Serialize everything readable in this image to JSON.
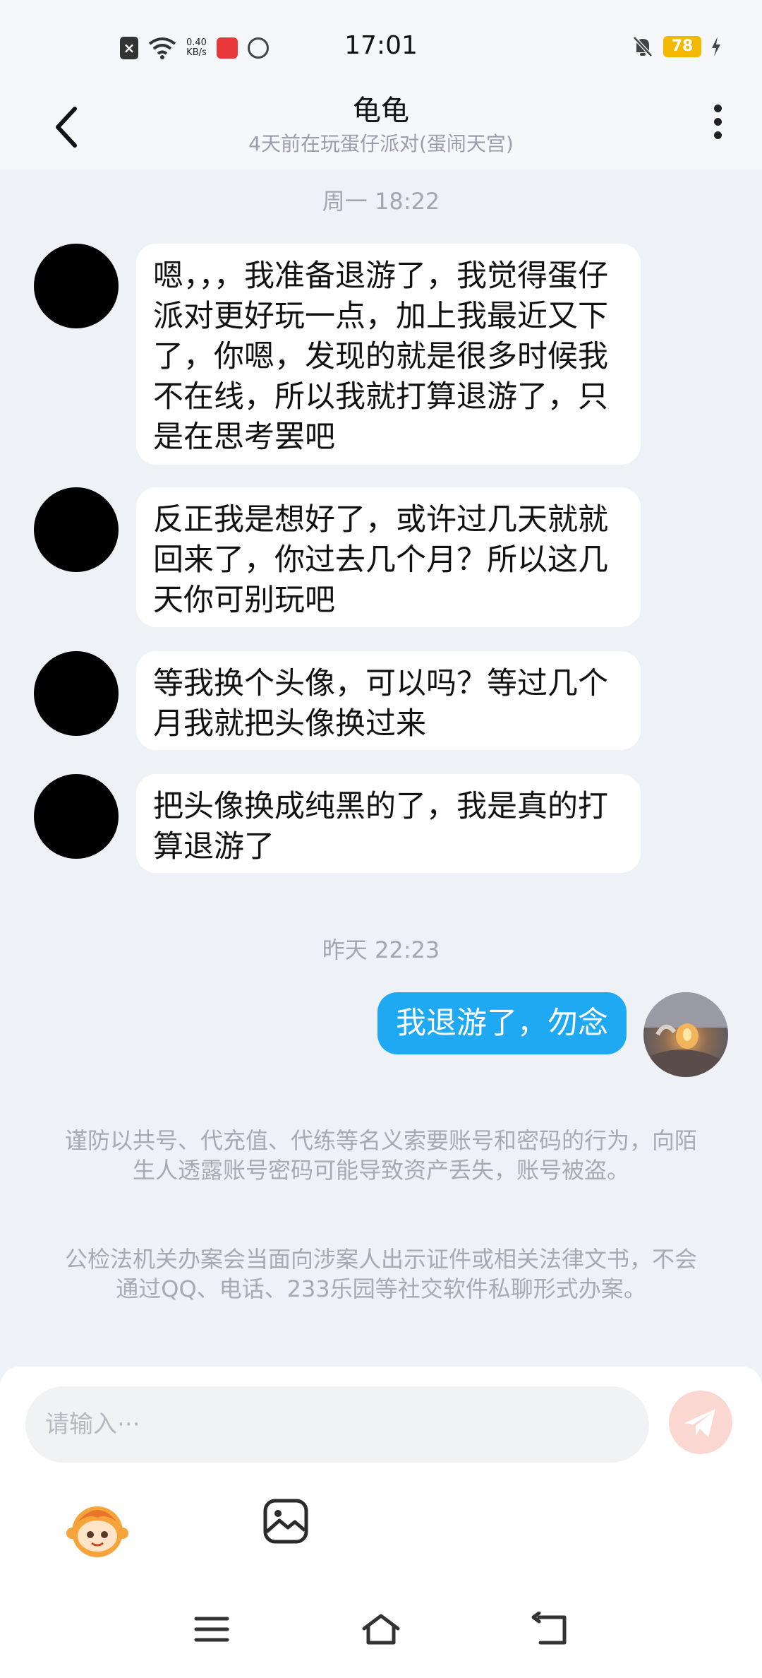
{
  "status_bar": {
    "time": "17:01",
    "net_speed_value": "0.40",
    "net_speed_unit": "KB/s",
    "battery": "78"
  },
  "header": {
    "title": "龟龟",
    "subtitle": "4天前在玩蛋仔派对(蛋闹天宫)"
  },
  "chat": {
    "timestamp1": "周一 18:22",
    "incoming": [
      "嗯，，，我准备退游了，我觉得蛋仔派对更好玩一点，加上我最近又下了，你嗯，发现的就是很多时候我不在线，所以我就打算退游了，只是在思考罢吧",
      "反正我是想好了，或许过几天就就回来了，你过去几个月？所以这几天你可别玩吧",
      "等我换个头像，可以吗？等过几个月我就把头像换过来",
      "把头像换成纯黑的了，我是真的打算退游了"
    ],
    "timestamp2": "昨天 22:23",
    "outgoing": "我退游了，勿念"
  },
  "notices": [
    "谨防以共号、代充值、代练等名义索要账号和密码的行为，向陌生人透露账号密码可能导致资产丢失，账号被盗。",
    "公检法机关办案会当面向涉案人出示证件或相关法律文书，不会通过QQ、电话、233乐园等社交软件私聊形式办案。"
  ],
  "input": {
    "placeholder": "请输入···"
  },
  "colors": {
    "accent": "#1fa9f3",
    "send_disabled": "#fbd7d2",
    "background": "#eef1f6"
  }
}
